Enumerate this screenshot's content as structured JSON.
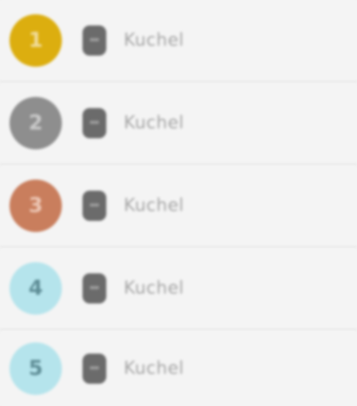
{
  "leaderboard": {
    "entries": [
      {
        "rank": "1",
        "name": "Kuchel",
        "badge_color": "#dcae0f",
        "badge_text_color": "#f0dc9a"
      },
      {
        "rank": "2",
        "name": "Kuchel",
        "badge_color": "#8e8e8e",
        "badge_text_color": "#c9c9c9"
      },
      {
        "rank": "3",
        "name": "Kuchel",
        "badge_color": "#c97e5d",
        "badge_text_color": "#ecc6b4"
      },
      {
        "rank": "4",
        "name": "Kuchel",
        "badge_color": "#b5e4ec",
        "badge_text_color": "#5e8d96"
      },
      {
        "rank": "5",
        "name": "Kuchel",
        "badge_color": "#b5e4ec",
        "badge_text_color": "#5e8d96"
      }
    ]
  },
  "icons": {
    "entry_icon": "gem-icon"
  }
}
